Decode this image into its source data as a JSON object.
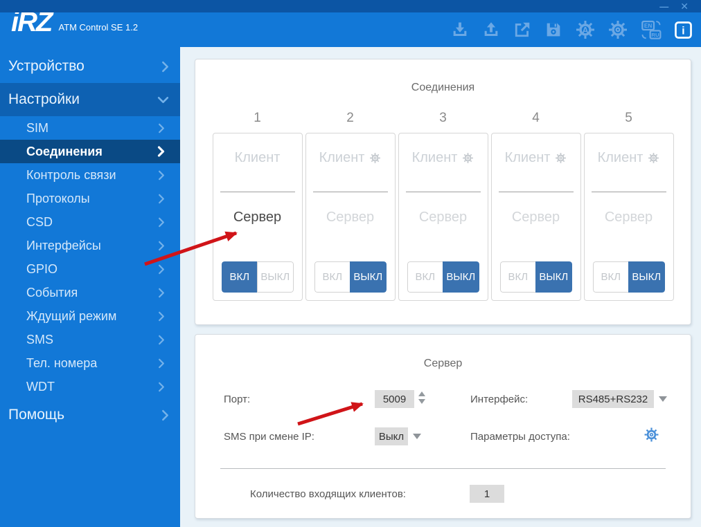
{
  "window": {
    "minimize_glyph": "—",
    "close_glyph": "✕"
  },
  "header": {
    "logo_text": "iRZ",
    "app_title": "ATM Control SE 1.2",
    "toolbar": {
      "gear_a_letter": "A",
      "lang_en": "EN",
      "lang_ru": "RU",
      "info_glyph": "i"
    }
  },
  "sidebar": {
    "items": [
      {
        "label": "Устройство"
      },
      {
        "label": "Настройки"
      },
      {
        "label": "SIM"
      },
      {
        "label": "Соединения"
      },
      {
        "label": "Контроль связи"
      },
      {
        "label": "Протоколы"
      },
      {
        "label": "CSD"
      },
      {
        "label": "Интерфейсы"
      },
      {
        "label": "GPIO"
      },
      {
        "label": "События"
      },
      {
        "label": "Ждущий режим"
      },
      {
        "label": "SMS"
      },
      {
        "label": "Тел. номера"
      },
      {
        "label": "WDT"
      },
      {
        "label": "Помощь"
      }
    ]
  },
  "connections": {
    "title": "Соединения",
    "client_label": "Клиент",
    "server_label": "Сервер",
    "on_label": "ВКЛ",
    "off_label": "ВЫКЛ",
    "cards": [
      {
        "number": "1",
        "mode": "Сервер",
        "state": "ВКЛ"
      },
      {
        "number": "2",
        "mode": "",
        "state": "ВЫКЛ"
      },
      {
        "number": "3",
        "mode": "",
        "state": "ВЫКЛ"
      },
      {
        "number": "4",
        "mode": "",
        "state": "ВЫКЛ"
      },
      {
        "number": "5",
        "mode": "",
        "state": "ВЫКЛ"
      }
    ]
  },
  "server_panel": {
    "title": "Сервер",
    "port_label": "Порт:",
    "port_value": "5009",
    "interface_label": "Интерфейс:",
    "interface_value": "RS485+RS232",
    "sms_label": "SMS при смене IP:",
    "sms_value": "Выкл",
    "access_label": "Параметры доступа:",
    "clients_label": "Количество входящих клиентов:",
    "clients_value": "1"
  },
  "colors": {
    "header_blue": "#1278d7",
    "titlebar_blue": "#0c55a4",
    "nav_expanded_blue": "#0e61b2",
    "nav_selected_blue": "#0a4a85",
    "toggle_active_blue": "#3a72b0",
    "main_bg": "#e9f2f8",
    "value_box_gray": "#dcdcdc",
    "arrow_red": "#d01418",
    "gear_blue": "#4a90d9"
  }
}
